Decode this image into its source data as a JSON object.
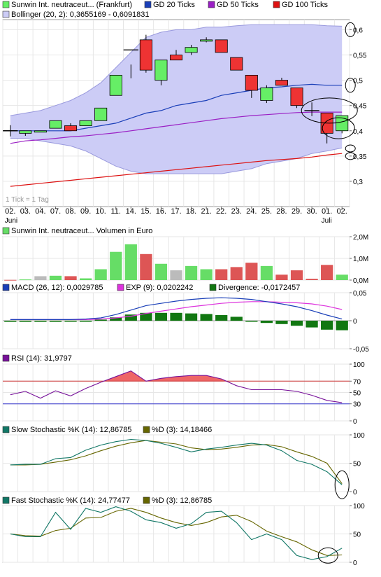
{
  "colors": {
    "up": "#66ee66",
    "down": "#ee3333",
    "ma20": "#1a3fb8",
    "ma50": "#9a1fc4",
    "ma100": "#dd1111",
    "band_fill": "#ccccf6",
    "band_line": "#9999dd",
    "vol_up": "#66dd66",
    "vol_down": "#dd5555",
    "vol_neutral": "#bbbbbb",
    "macd": "#1a3fb8",
    "exp": "#dd33dd",
    "div": "#117711",
    "rsi": "#771199",
    "rsi_fill": "#ee6666",
    "rsi70": "#cc3333",
    "rsi30": "#3333cc",
    "k_line": "#117766",
    "d_line": "#666600"
  },
  "legend": {
    "main_title": "Sunwin Int. neutraceut... (Frankfurt)",
    "gd20": "GD 20 Ticks",
    "gd50": "GD 50 Ticks",
    "gd100": "GD 100 Ticks",
    "bollinger": "Bollinger (20, 2): 0,3655169 - 0,6091831",
    "tick_note": "1 Tick = 1 Tag",
    "volume": "Sunwin Int. neutraceut... Volumen in Euro",
    "macd": "MACD (26, 12): 0,0029785",
    "exp": "EXP (9): 0,0202242",
    "divergence": "Divergence: -0,0172457",
    "rsi": "RSI (14): 31,9797",
    "slow_k": "Slow Stochastic %K (14): 12,86785",
    "slow_d": "%D (3): 14,18466",
    "fast_k": "Fast Stochastic %K (14): 24,77477",
    "fast_d": "%D (3): 12,86785"
  },
  "x_labels": [
    "02.",
    "03.",
    "04.",
    "07.",
    "08.",
    "09.",
    "10.",
    "11.",
    "14.",
    "15.",
    "16.",
    "17.",
    "18.",
    "21.",
    "22.",
    "23.",
    "24.",
    "25.",
    "28.",
    "29.",
    "30.",
    "01.",
    "02."
  ],
  "month_labels": [
    {
      "index": 0,
      "text": "Juni"
    },
    {
      "index": 21,
      "text": "Juli"
    }
  ],
  "chart_data": [
    {
      "type": "candlestick",
      "ylim": [
        0.25,
        0.62
      ],
      "yticks": [
        {
          "v": 0.6,
          "label": "0,6"
        },
        {
          "v": 0.55,
          "label": "0,55"
        },
        {
          "v": 0.5,
          "label": "0,5"
        },
        {
          "v": 0.45,
          "label": "0,45"
        },
        {
          "v": 0.4,
          "label": "0,4"
        },
        {
          "v": 0.35,
          "label": "0,35"
        },
        {
          "v": 0.3,
          "label": "0,3"
        }
      ],
      "ohlc": [
        [
          0.4,
          0.4,
          0.4,
          0.4
        ],
        [
          0.395,
          0.4,
          0.39,
          0.4
        ],
        [
          0.4,
          0.4,
          0.4,
          0.4
        ],
        [
          0.405,
          0.42,
          0.405,
          0.42
        ],
        [
          0.41,
          0.415,
          0.4,
          0.4
        ],
        [
          0.41,
          0.42,
          0.41,
          0.42
        ],
        [
          0.42,
          0.445,
          0.42,
          0.445
        ],
        [
          0.47,
          0.48,
          0.47,
          0.51
        ],
        [
          0.515,
          0.52,
          0.515,
          0.56
        ],
        [
          0.58,
          0.59,
          0.515,
          0.52
        ],
        [
          0.5,
          0.54,
          0.49,
          0.54
        ],
        [
          0.55,
          0.56,
          0.54,
          0.54
        ],
        [
          0.555,
          0.57,
          0.55,
          0.565
        ],
        [
          0.58,
          0.585,
          0.575,
          0.58
        ],
        [
          0.58,
          0.58,
          0.555,
          0.555
        ],
        [
          0.545,
          0.545,
          0.52,
          0.52
        ],
        [
          0.51,
          0.51,
          0.465,
          0.48
        ],
        [
          0.46,
          0.49,
          0.455,
          0.485
        ],
        [
          0.5,
          0.505,
          0.49,
          0.49
        ],
        [
          0.485,
          0.485,
          0.445,
          0.45
        ],
        [
          0.44,
          0.445,
          0.44,
          0.44
        ],
        [
          0.435,
          0.435,
          0.375,
          0.395
        ],
        [
          0.4,
          0.43,
          0.395,
          0.43
        ]
      ],
      "cross_days": [
        0,
        8,
        20
      ],
      "boll_upper": [
        0.43,
        0.435,
        0.44,
        0.45,
        0.46,
        0.475,
        0.495,
        0.525,
        0.555,
        0.585,
        0.595,
        0.6,
        0.6,
        0.605,
        0.605,
        0.608,
        0.61,
        0.61,
        0.61,
        0.61,
        0.61,
        0.608,
        0.607
      ],
      "boll_lower": [
        0.385,
        0.385,
        0.38,
        0.375,
        0.37,
        0.36,
        0.345,
        0.33,
        0.32,
        0.315,
        0.315,
        0.315,
        0.315,
        0.315,
        0.315,
        0.32,
        0.325,
        0.335,
        0.34,
        0.345,
        0.355,
        0.36,
        0.366
      ],
      "gd20": [
        0.4,
        0.4,
        0.4,
        0.4,
        0.4,
        0.405,
        0.41,
        0.415,
        0.425,
        0.435,
        0.44,
        0.45,
        0.455,
        0.46,
        0.47,
        0.475,
        0.48,
        0.485,
        0.487,
        0.49,
        0.492,
        0.49,
        0.49
      ],
      "gd50": [
        0.375,
        0.38,
        0.382,
        0.385,
        0.388,
        0.39,
        0.393,
        0.396,
        0.4,
        0.404,
        0.408,
        0.412,
        0.416,
        0.42,
        0.424,
        0.427,
        0.43,
        0.432,
        0.434,
        0.436,
        0.437,
        0.437,
        0.437
      ],
      "gd100": [
        0.29,
        0.293,
        0.296,
        0.299,
        0.302,
        0.305,
        0.308,
        0.311,
        0.314,
        0.317,
        0.32,
        0.323,
        0.326,
        0.329,
        0.332,
        0.335,
        0.338,
        0.341,
        0.343,
        0.345,
        0.348,
        0.352,
        0.355
      ]
    },
    {
      "type": "bar",
      "ylim": [
        0,
        2000000
      ],
      "yticks": [
        {
          "v": 2000000,
          "label": "2,0M"
        },
        {
          "v": 1000000,
          "label": "1,0M"
        },
        {
          "v": 0,
          "label": "0,0M"
        }
      ],
      "values": [
        10000,
        30000,
        180000,
        200000,
        180000,
        80000,
        500000,
        1300000,
        1650000,
        1200000,
        750000,
        450000,
        650000,
        500000,
        500000,
        600000,
        800000,
        650000,
        250000,
        450000,
        60000,
        700000,
        250000
      ],
      "colors": [
        "vol_down",
        "vol_up",
        "vol_neutral",
        "vol_up",
        "vol_down",
        "vol_up",
        "vol_up",
        "vol_up",
        "vol_up",
        "vol_down",
        "vol_up",
        "vol_neutral",
        "vol_up",
        "vol_up",
        "vol_down",
        "vol_down",
        "vol_down",
        "vol_up",
        "vol_down",
        "vol_down",
        "vol_down",
        "vol_down",
        "vol_up"
      ]
    },
    {
      "type": "line",
      "ylim": [
        -0.05,
        0.05
      ],
      "yticks": [
        {
          "v": 0.05,
          "label": "0,05"
        },
        {
          "v": 0,
          "label": "0"
        },
        {
          "v": -0.05,
          "label": "-0,05"
        }
      ],
      "macd": [
        0.002,
        0.002,
        0.002,
        0.002,
        0.002,
        0.003,
        0.005,
        0.011,
        0.019,
        0.027,
        0.031,
        0.035,
        0.038,
        0.04,
        0.041,
        0.04,
        0.038,
        0.034,
        0.03,
        0.025,
        0.018,
        0.01,
        0.003
      ],
      "exp": [
        0.002,
        0.002,
        0.002,
        0.002,
        0.002,
        0.002,
        0.003,
        0.005,
        0.008,
        0.013,
        0.017,
        0.021,
        0.025,
        0.028,
        0.031,
        0.033,
        0.034,
        0.034,
        0.033,
        0.032,
        0.03,
        0.026,
        0.02
      ],
      "divergence": [
        -0.002,
        -0.002,
        -0.002,
        -0.002,
        -0.001,
        0,
        0.002,
        0.006,
        0.011,
        0.014,
        0.014,
        0.014,
        0.013,
        0.012,
        0.01,
        0.007,
        0,
        -0.004,
        -0.006,
        -0.009,
        -0.012,
        -0.016,
        -0.017
      ]
    },
    {
      "type": "line",
      "ylim": [
        0,
        100
      ],
      "yticks": [
        {
          "v": 100,
          "label": "100"
        },
        {
          "v": 70,
          "label": "70"
        },
        {
          "v": 50,
          "label": "50"
        },
        {
          "v": 30,
          "label": "30"
        },
        {
          "v": 0,
          "label": "0"
        }
      ],
      "ref_lines": [
        70,
        30
      ],
      "values": [
        46,
        52,
        40,
        53,
        44,
        57,
        68,
        78,
        88,
        70,
        75,
        78,
        80,
        80,
        74,
        62,
        55,
        55,
        55,
        52,
        45,
        36,
        32
      ]
    },
    {
      "type": "line",
      "ylim": [
        0,
        100
      ],
      "yticks": [
        {
          "v": 100,
          "label": "100"
        },
        {
          "v": 50,
          "label": "50"
        },
        {
          "v": 0,
          "label": "0"
        }
      ],
      "k": [
        47,
        48,
        48,
        58,
        60,
        73,
        82,
        88,
        92,
        90,
        85,
        78,
        70,
        75,
        78,
        82,
        85,
        82,
        72,
        55,
        48,
        35,
        12
      ],
      "d": [
        47,
        47,
        48,
        52,
        56,
        63,
        72,
        80,
        86,
        90,
        87,
        84,
        77,
        74,
        75,
        78,
        82,
        83,
        79,
        70,
        62,
        50,
        14
      ]
    },
    {
      "type": "line",
      "ylim": [
        0,
        100
      ],
      "yticks": [
        {
          "v": 100,
          "label": "100"
        },
        {
          "v": 50,
          "label": "50"
        },
        {
          "v": 0,
          "label": "0"
        }
      ],
      "k": [
        50,
        45,
        45,
        88,
        58,
        95,
        88,
        98,
        90,
        75,
        70,
        60,
        68,
        88,
        90,
        70,
        40,
        50,
        40,
        12,
        5,
        10,
        25
      ],
      "d": [
        50,
        47,
        46,
        56,
        60,
        78,
        79,
        90,
        95,
        88,
        78,
        70,
        65,
        70,
        80,
        83,
        72,
        55,
        45,
        36,
        22,
        12,
        13
      ]
    }
  ]
}
